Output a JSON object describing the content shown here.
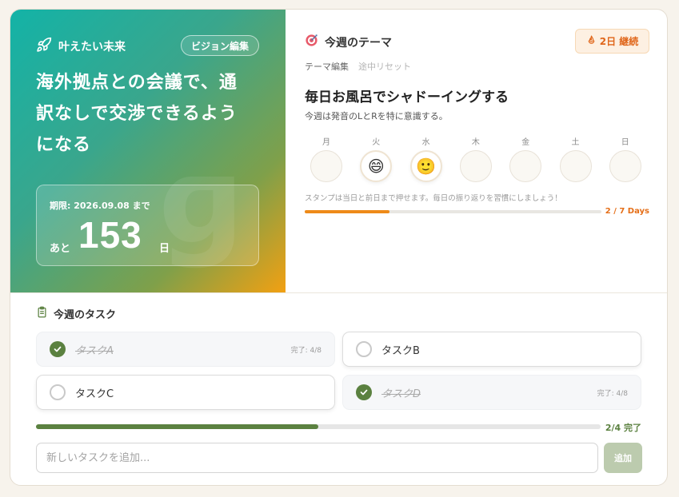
{
  "vision": {
    "label": "叶えたい未来",
    "edit_button": "ビジョン編集",
    "text": "海外拠点との会議で、通訳なしで交渉できるようになる",
    "deadline_label": "期限: 2026.09.08 まで",
    "remaining_prefix": "あと",
    "remaining_days": "153",
    "remaining_unit": "日"
  },
  "theme": {
    "title": "今週のテーマ",
    "streak": "2日 継続",
    "edit_link": "テーマ編集",
    "reset_link": "途中リセット",
    "main": "毎日お風呂でシャドーイングする",
    "sub": "今週は発音のLとRを特に意識する。",
    "days": [
      {
        "label": "月",
        "stamp": ""
      },
      {
        "label": "火",
        "stamp": "😄"
      },
      {
        "label": "水",
        "stamp": "🙂"
      },
      {
        "label": "木",
        "stamp": ""
      },
      {
        "label": "金",
        "stamp": ""
      },
      {
        "label": "土",
        "stamp": ""
      },
      {
        "label": "日",
        "stamp": ""
      }
    ],
    "stamp_note": "スタンプは当日と前日まで押せます。毎日の振り返りを習慣にしましょう！",
    "progress_done": 2,
    "progress_total": 7,
    "progress_text": "2 / 7 Days",
    "accent_color": "#ee8a19"
  },
  "tasks": {
    "title": "今週のタスク",
    "items": [
      {
        "name": "タスクA",
        "done": true,
        "meta": "完了: 4/8"
      },
      {
        "name": "タスクB",
        "done": false,
        "meta": ""
      },
      {
        "name": "タスクC",
        "done": false,
        "meta": ""
      },
      {
        "name": "タスクD",
        "done": true,
        "meta": "完了: 4/8"
      }
    ],
    "progress_done": 2,
    "progress_total": 4,
    "progress_text": "2/4 完了",
    "input_placeholder": "新しいタスクを追加...",
    "add_button": "追加",
    "accent_color": "#5b8140"
  }
}
